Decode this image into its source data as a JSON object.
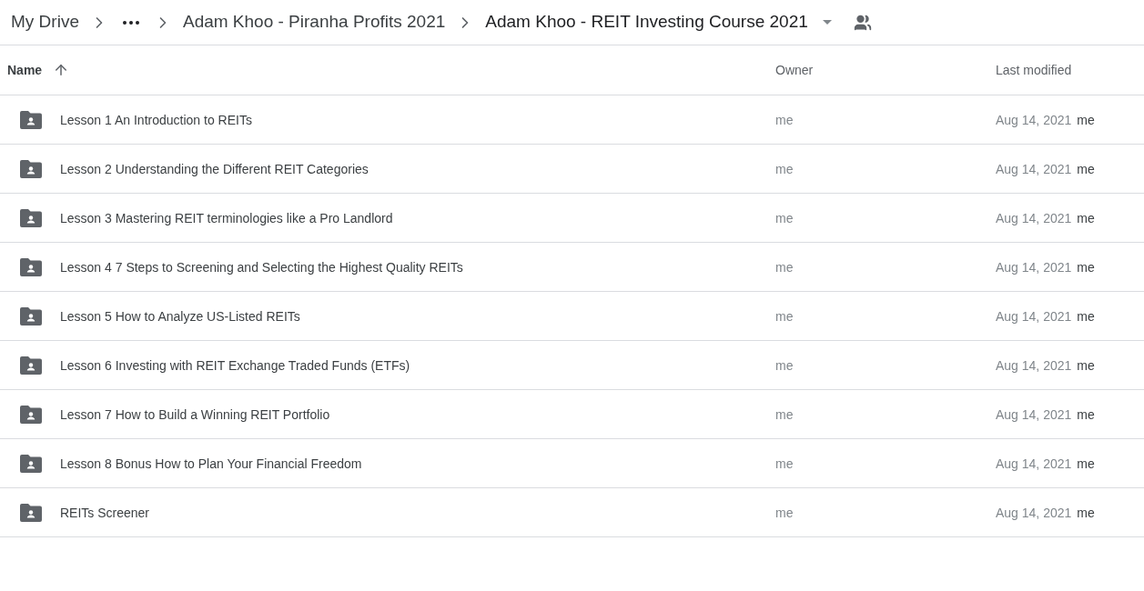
{
  "breadcrumb": [
    {
      "kind": "link",
      "label": "My Drive"
    },
    {
      "kind": "more"
    },
    {
      "kind": "link",
      "label": "Adam Khoo - Piranha Profits 2021"
    },
    {
      "kind": "current",
      "label": "Adam Khoo - REIT Investing Course 2021"
    }
  ],
  "table": {
    "columns": [
      {
        "label": "Name",
        "sorted": true
      },
      {
        "label": "Owner",
        "sorted": false
      },
      {
        "label": "Last modified",
        "sorted": false
      }
    ],
    "rows": [
      {
        "name": "Lesson 1 An Introduction to REITs",
        "owner": "me",
        "modified": "Aug 14, 2021",
        "modified_by": "me"
      },
      {
        "name": "Lesson 2 Understanding the Different REIT Categories",
        "owner": "me",
        "modified": "Aug 14, 2021",
        "modified_by": "me"
      },
      {
        "name": "Lesson 3 Mastering REIT terminologies like a Pro Landlord",
        "owner": "me",
        "modified": "Aug 14, 2021",
        "modified_by": "me"
      },
      {
        "name": "Lesson 4 7 Steps to Screening and Selecting the Highest Quality REITs",
        "owner": "me",
        "modified": "Aug 14, 2021",
        "modified_by": "me"
      },
      {
        "name": "Lesson 5 How to Analyze US-Listed REITs",
        "owner": "me",
        "modified": "Aug 14, 2021",
        "modified_by": "me"
      },
      {
        "name": "Lesson 6 Investing with REIT Exchange Traded Funds (ETFs)",
        "owner": "me",
        "modified": "Aug 14, 2021",
        "modified_by": "me"
      },
      {
        "name": "Lesson 7 How to Build a Winning REIT Portfolio",
        "owner": "me",
        "modified": "Aug 14, 2021",
        "modified_by": "me"
      },
      {
        "name": "Lesson 8 Bonus How to Plan Your Financial Freedom",
        "owner": "me",
        "modified": "Aug 14, 2021",
        "modified_by": "me"
      },
      {
        "name": "REITs Screener",
        "owner": "me",
        "modified": "Aug 14, 2021",
        "modified_by": "me"
      }
    ]
  }
}
